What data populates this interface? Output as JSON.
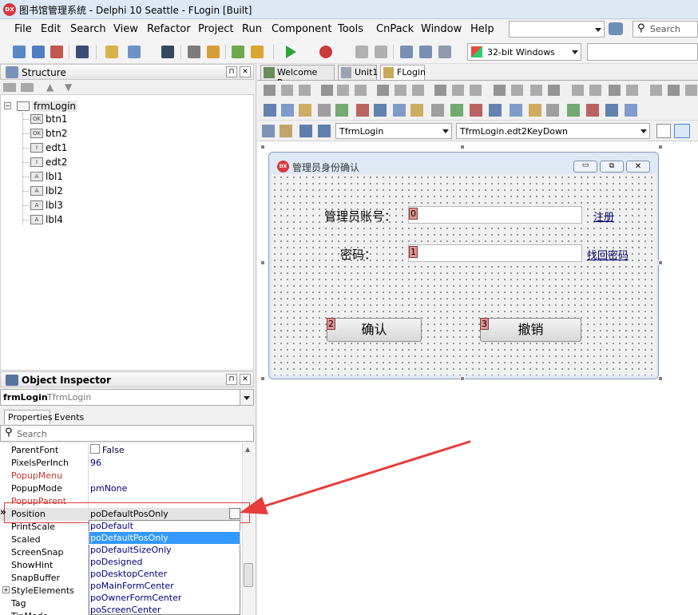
{
  "window": {
    "title": "图书馆管理系统 - Delphi 10 Seattle - FLogin [Built]",
    "icon": "DX"
  },
  "menu": [
    "File",
    "Edit",
    "Search",
    "View",
    "Refactor",
    "Project",
    "Run",
    "Component",
    "Tools",
    "CnPack",
    "Window",
    "Help"
  ],
  "search_placeholder": "Search",
  "platform": "32-bit Windows",
  "structure": {
    "title": "Structure",
    "root": "frmLogin",
    "items": [
      "btn1",
      "btn2",
      "edt1",
      "edt2",
      "lbl1",
      "lbl2",
      "lbl3",
      "lbl4"
    ],
    "item_icons": [
      "OK",
      "OK",
      "I",
      "I",
      "A",
      "A",
      "A",
      "A"
    ]
  },
  "inspector": {
    "title": "Object Inspector",
    "object": "frmLogin",
    "object_type": "TfrmLogin",
    "tabs": [
      "Properties",
      "Events"
    ],
    "search_placeholder": "Search",
    "properties": [
      {
        "name": "ParentFont",
        "value": "False",
        "red": false
      },
      {
        "name": "PixelsPerInch",
        "value": "96",
        "red": false
      },
      {
        "name": "PopupMenu",
        "value": "",
        "red": true
      },
      {
        "name": "PopupMode",
        "value": "pmNone",
        "red": false
      },
      {
        "name": "PopupParent",
        "value": "",
        "red": true
      },
      {
        "name": "Position",
        "value": "poDefaultPosOnly",
        "red": false
      },
      {
        "name": "PrintScale",
        "value": "",
        "red": false
      },
      {
        "name": "Scaled",
        "value": "",
        "red": false
      },
      {
        "name": "ScreenSnap",
        "value": "",
        "red": false
      },
      {
        "name": "ShowHint",
        "value": "",
        "red": false
      },
      {
        "name": "SnapBuffer",
        "value": "",
        "red": false
      },
      {
        "name": "StyleElements",
        "value": "",
        "red": false
      },
      {
        "name": "Tag",
        "value": "",
        "red": false
      },
      {
        "name": "TipMode",
        "value": "",
        "red": false
      }
    ],
    "position_options": [
      "poDefault",
      "poDefaultPosOnly",
      "poDefaultSizeOnly",
      "poDesigned",
      "poDesktopCenter",
      "poMainFormCenter",
      "poOwnerFormCenter",
      "poScreenCenter"
    ],
    "selected_option": "poDefaultPosOnly"
  },
  "editor": {
    "tabs": [
      "Welcome Page",
      "Unit1",
      "FLogin"
    ],
    "active_tab": "FLogin",
    "class_combo": "TfrmLogin",
    "method_combo": "TfrmLogin.edt2KeyDown"
  },
  "form": {
    "icon": "DX",
    "caption": "管理员身份确认",
    "lbl_account": "管理员账号：",
    "lbl_password": "密码：",
    "link_register": "注册",
    "link_recover": "找回密码",
    "confirm": "确认",
    "cancel": "撤销",
    "tab_orders": [
      "0",
      "1",
      "2",
      "3"
    ]
  },
  "colors": {
    "accent": "#e63c3c",
    "selection": "#3399ff",
    "form_title": "#dfe9f5"
  }
}
